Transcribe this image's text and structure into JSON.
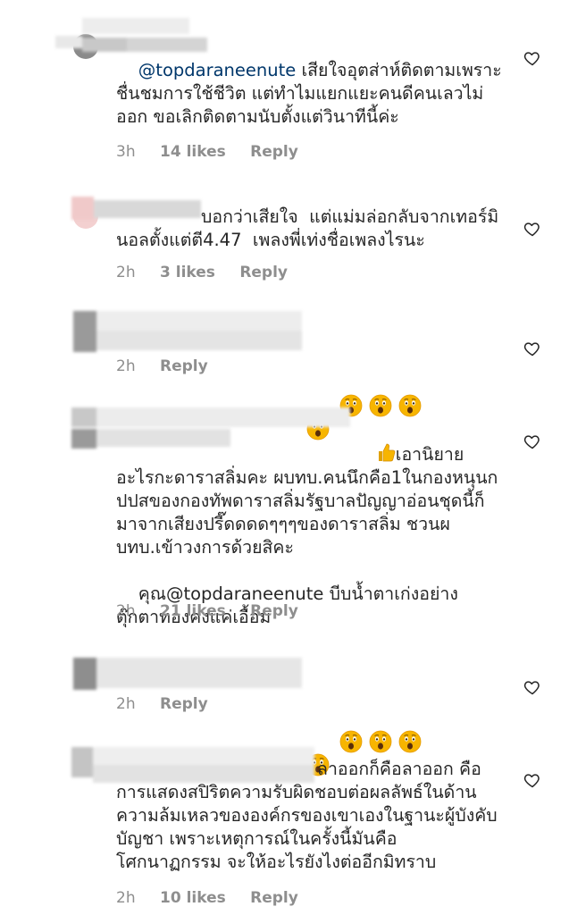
{
  "comments": [
    {
      "mention": "@topdaraneenute",
      "text_after_mention": " เสียใจอุตส่าห์ติดตามเพราะชื่นชมการใช้ชีวิต แต่ทำไมแยกแยะคนดีคนเลวไม่ออก ขอเลิกติดตามนับตั้งแต่วินาทีนี้ค่ะ",
      "time": "3h",
      "likes": "14 likes",
      "reply": "Reply"
    },
    {
      "text": "บอกว่าเสียใจ  แต่แม่มล่อกลับจากเทอร์มินอลตั้งแต่ตี4.47  เพลงพี่เท่งชื่อเพลงไรนะ",
      "time": "2h",
      "likes": "3 likes",
      "reply": "Reply"
    },
    {
      "emoji": "astonished-face x4",
      "time": "2h",
      "reply": "Reply"
    },
    {
      "emoji": "thumbs-up",
      "text": "เอานิยายอะไรกะดาราสลิ่มคะ ผบทบ.คนนึกคือ1ในกองหนุนกปปสของกองทัพดาราสลิ่มรัฐบาลปัญญาอ่อนชุดนี้ก็มาจากเสียงปรี๊ดดดดๆๆๆของดาราสลิ่ม ชวนผบทบ.เข้าวงการด้วยสิคะ",
      "mention_line_prefix": "คุณ",
      "mention": "@topdaraneenute",
      "text_after_mention": " บีบน้ำตาเก่งอย่างตุ๊กตาทองคงแค่เอื้อม",
      "time": "2h",
      "likes": "21 likes",
      "reply": "Reply"
    },
    {
      "emoji": "astonished-face x4",
      "time": "2h",
      "reply": "Reply"
    },
    {
      "text": "ลาออกก็คือลาออก คือการแสดงสปิริตความรับผิดชอบต่อผลลัพธ์ในด้านความล้มเหลวขององค์กรของเขาเองในฐานะผู้บังคับบัญชา เพราะเหตุการณ์ในครั้งนี้มันคือโศกนาฏกรรม จะให้อะไรยังไงต่ออีกมิทราบ",
      "time": "2h",
      "likes": "10 likes",
      "reply": "Reply"
    }
  ],
  "colors": {
    "text": "#262626",
    "meta": "#8e8e8e",
    "mention": "#00376b",
    "emoji": "#f7b500"
  }
}
